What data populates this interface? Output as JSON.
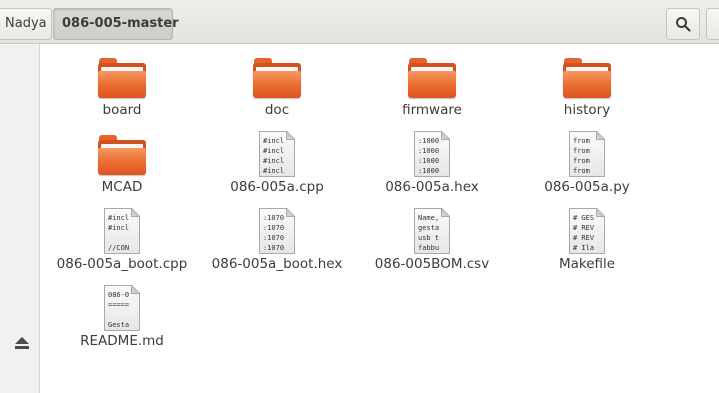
{
  "breadcrumb": {
    "parent": "Nadya",
    "current": "086-005-master"
  },
  "toolbar": {
    "search_icon": "search-icon"
  },
  "sidebar": {
    "eject_icon": "eject-icon"
  },
  "files": [
    {
      "name": "board",
      "type": "folder"
    },
    {
      "name": "doc",
      "type": "folder"
    },
    {
      "name": "firmware",
      "type": "folder"
    },
    {
      "name": "history",
      "type": "folder"
    },
    {
      "name": "MCAD",
      "type": "folder"
    },
    {
      "name": "086-005a.cpp",
      "type": "text",
      "preview": "#incl\n#incl\n#incl\n#incl"
    },
    {
      "name": "086-005a.hex",
      "type": "text",
      "preview": ":1000\n:1000\n:1000\n:1000"
    },
    {
      "name": "086-005a.py",
      "type": "text",
      "preview": "from\nfrom\nfrom\nfrom"
    },
    {
      "name": "086-005a_boot.cpp",
      "type": "text",
      "preview": "#incl\n#incl\n\n//CON"
    },
    {
      "name": "086-005a_boot.hex",
      "type": "text",
      "preview": ":1070\n:1070\n:1070\n:1070"
    },
    {
      "name": "086-005BOM.csv",
      "type": "text",
      "preview": "Name,\ngesta\nusb t\nfabbu"
    },
    {
      "name": "Makefile",
      "type": "text",
      "preview": "# GES\n# REV\n# REV\n# Ila"
    },
    {
      "name": "README.md",
      "type": "text",
      "preview": "086-0\n=====\n\nGesta"
    }
  ]
}
